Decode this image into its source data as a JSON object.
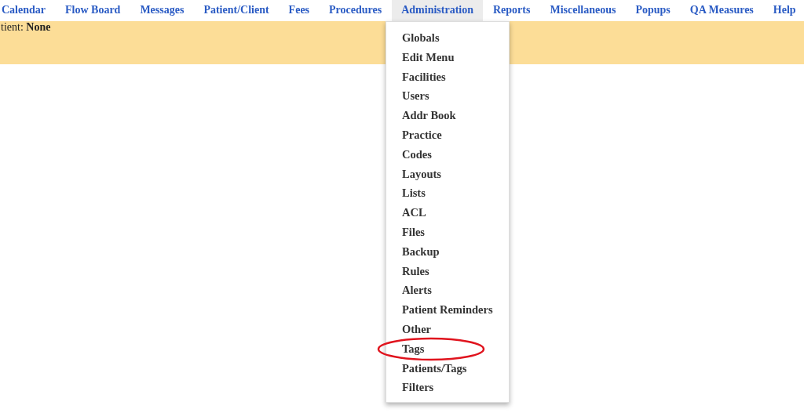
{
  "nav": [
    {
      "label": "Calendar",
      "selected": false
    },
    {
      "label": "Flow Board",
      "selected": false
    },
    {
      "label": "Messages",
      "selected": false
    },
    {
      "label": "Patient/Client",
      "selected": false
    },
    {
      "label": "Fees",
      "selected": false
    },
    {
      "label": "Procedures",
      "selected": false
    },
    {
      "label": "Administration",
      "selected": true
    },
    {
      "label": "Reports",
      "selected": false
    },
    {
      "label": "Miscellaneous",
      "selected": false
    },
    {
      "label": "Popups",
      "selected": false
    },
    {
      "label": "QA Measures",
      "selected": false
    },
    {
      "label": "Help",
      "selected": false
    }
  ],
  "patient_bar": {
    "text": "tient: **None**"
  },
  "admin_menu": [
    {
      "label": "Globals",
      "circled": false
    },
    {
      "label": "Edit Menu",
      "circled": false
    },
    {
      "label": "Facilities",
      "circled": false
    },
    {
      "label": "Users",
      "circled": false
    },
    {
      "label": "Addr Book",
      "circled": false
    },
    {
      "label": "Practice",
      "circled": false
    },
    {
      "label": "Codes",
      "circled": false
    },
    {
      "label": "Layouts",
      "circled": false
    },
    {
      "label": "Lists",
      "circled": false
    },
    {
      "label": "ACL",
      "circled": false
    },
    {
      "label": "Files",
      "circled": false
    },
    {
      "label": "Backup",
      "circled": false
    },
    {
      "label": "Rules",
      "circled": false
    },
    {
      "label": "Alerts",
      "circled": false
    },
    {
      "label": "Patient Reminders",
      "circled": false
    },
    {
      "label": "Other",
      "circled": false
    },
    {
      "label": "Tags",
      "circled": true
    },
    {
      "label": "Patients/Tags",
      "circled": false
    },
    {
      "label": "Filters",
      "circled": false
    }
  ]
}
